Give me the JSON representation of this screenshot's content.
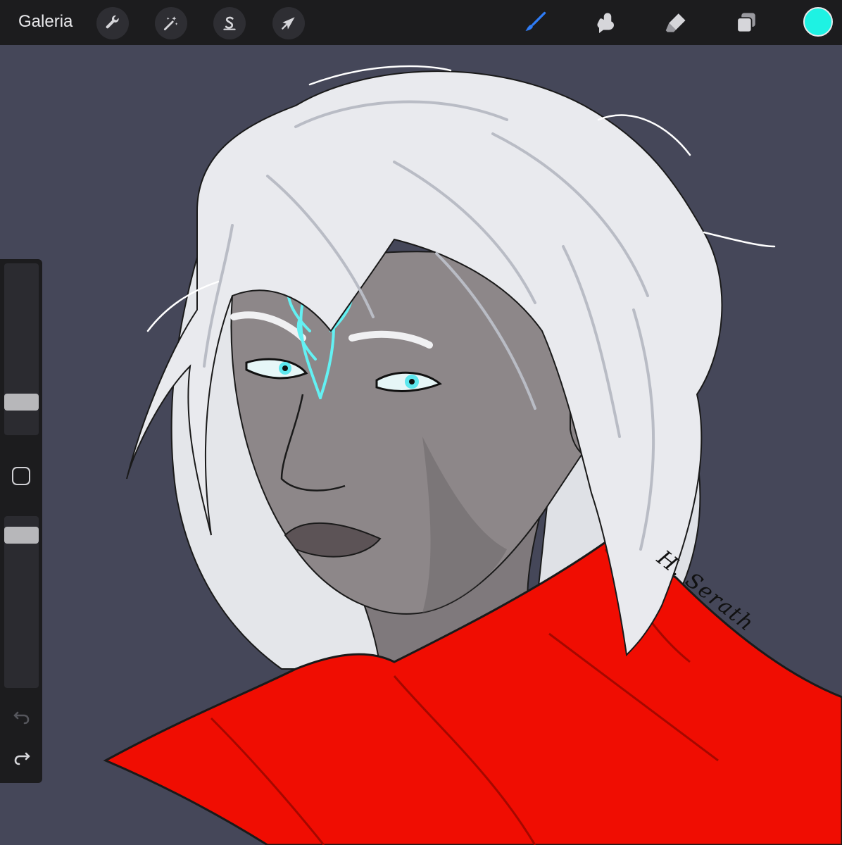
{
  "topbar": {
    "gallery_label": "Galeria",
    "left_tools": [
      {
        "name": "actions",
        "icon": "wrench-icon"
      },
      {
        "name": "adjustments",
        "icon": "magic-wand-icon"
      },
      {
        "name": "selection",
        "icon": "selection-s-icon"
      },
      {
        "name": "transform",
        "icon": "arrow-cursor-icon"
      }
    ],
    "right_tools": [
      {
        "name": "brush",
        "icon": "brush-icon",
        "active": true
      },
      {
        "name": "smudge",
        "icon": "smudge-finger-icon"
      },
      {
        "name": "eraser",
        "icon": "eraser-icon"
      },
      {
        "name": "layers",
        "icon": "layers-icon"
      }
    ],
    "current_color": "#1ef2e3",
    "accent_color": "#2f7cf6"
  },
  "sidebar": {
    "brush_size_level": 0.16,
    "opacity_level": 0.93,
    "modify_icon": "square-outline-icon",
    "undo_icon": "undo-arrow-icon",
    "redo_icon": "redo-arrow-icon"
  },
  "canvas": {
    "background_color": "#454759",
    "signature": "H. Serath"
  }
}
